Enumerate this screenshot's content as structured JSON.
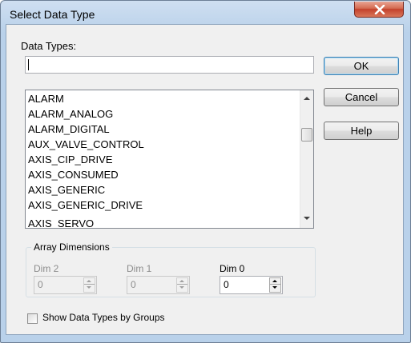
{
  "dialog": {
    "title": "Select Data Type",
    "close_label": "X"
  },
  "data_types": {
    "label": "Data Types:",
    "input_value": "",
    "items": [
      "ALARM",
      "ALARM_ANALOG",
      "ALARM_DIGITAL",
      "AUX_VALVE_CONTROL",
      "AXIS_CIP_DRIVE",
      "AXIS_CONSUMED",
      "AXIS_GENERIC",
      "AXIS_GENERIC_DRIVE",
      "AXIS_SERVO"
    ]
  },
  "buttons": {
    "ok": "OK",
    "cancel": "Cancel",
    "help": "Help"
  },
  "array_dimensions": {
    "legend": "Array Dimensions",
    "dim2": {
      "label": "Dim 2",
      "value": "0",
      "enabled": false
    },
    "dim1": {
      "label": "Dim 1",
      "value": "0",
      "enabled": false
    },
    "dim0": {
      "label": "Dim 0",
      "value": "0",
      "enabled": true
    }
  },
  "show_by_groups": {
    "label": "Show Data Types by Groups",
    "checked": false
  },
  "icons": {
    "close": "close-icon",
    "scroll_up": "scroll-up-arrow-icon",
    "scroll_down": "scroll-down-arrow-icon",
    "spin_up": "spin-up-arrow-icon",
    "spin_down": "spin-down-arrow-icon"
  },
  "colors": {
    "frame": "#b9d1ea",
    "close_button": "#c3412c",
    "dialog_face": "#f0f0f0",
    "disabled_text": "#8d8d8d"
  }
}
